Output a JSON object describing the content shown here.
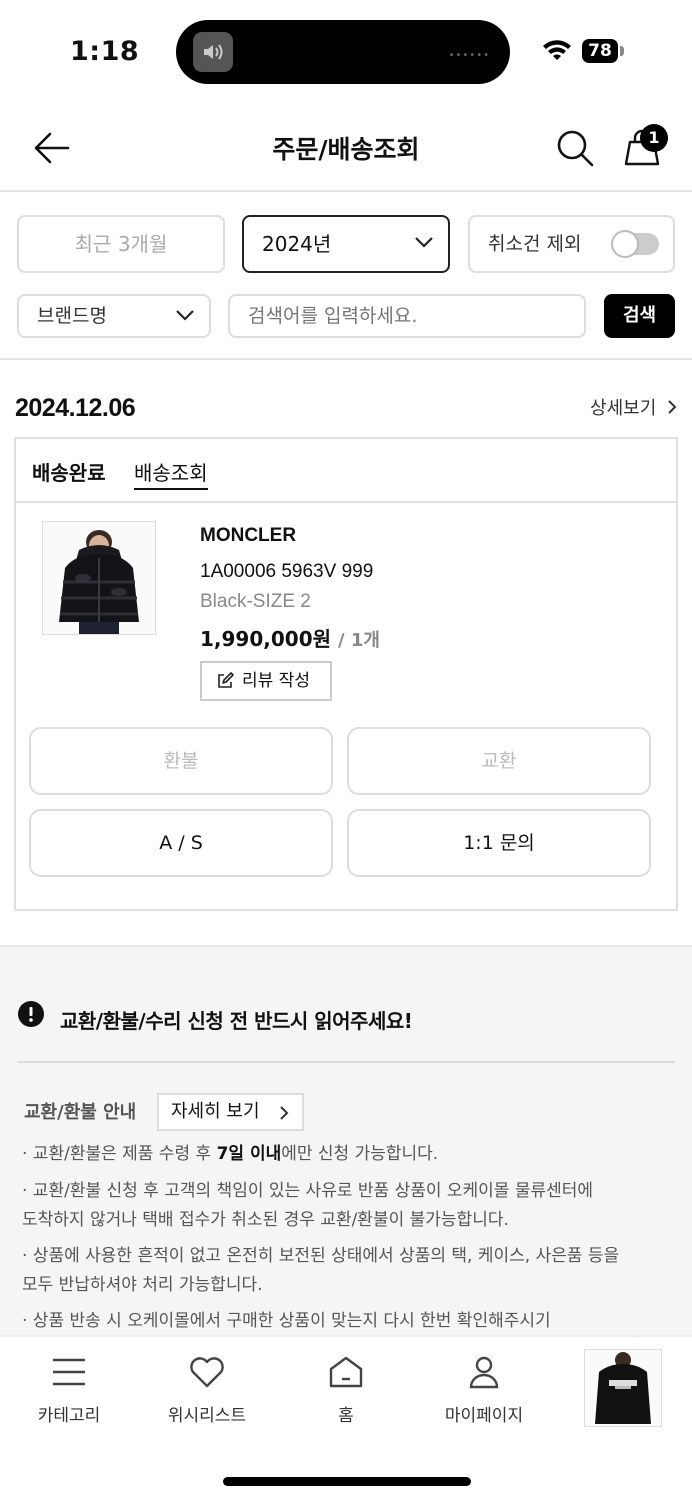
{
  "status_bar": {
    "time": "1:18",
    "battery": "78"
  },
  "header": {
    "title": "주문/배송조회",
    "cart_count": "1"
  },
  "filters": {
    "period": "최근 3개월",
    "year": "2024년",
    "exclude_cancel": "취소건 제외",
    "exclude_cancel_on": false,
    "brand": "브랜드명",
    "search_placeholder": "검색어를 입력하세요.",
    "search_button": "검색"
  },
  "order": {
    "date": "2024.12.06",
    "detail_link": "상세보기",
    "status": "배송완료",
    "tracking": "배송조회",
    "product": {
      "brand": "MONCLER",
      "code": "1A00006 5963V 999",
      "option": "Black-SIZE 2",
      "price": "1,990,000원",
      "qty": "/ 1개"
    },
    "review_button": "리뷰 작성",
    "actions": [
      "환불",
      "교환",
      "A / S",
      "1:1 문의"
    ]
  },
  "notice": {
    "title": "교환/환불/수리 신청 전 반드시 읽어주세요!",
    "guide_label": "교환/환불 안내",
    "guide_button": "자세히 보기",
    "l1_pre": "· 교환/환불은 제품 수령 후 ",
    "l1_bold": "7일 이내",
    "l1_post": "에만 신청 가능합니다.",
    "l2a": "· 교환/환불 신청 후 고객의 책임이 있는 사유로 반품 상품이 오케이몰 물류센터에",
    "l2b": "도착하지 않거나 택배 접수가 취소된 경우 교환/환불이 불가능합니다.",
    "l3a": "· 상품에 사용한 흔적이 없고 온전히 보전된 상태에서 상품의 택, 케이스, 사은품 등을",
    "l3b": "모두 반납하셔야 처리 가능합니다.",
    "l4": "· 상품 반송 시 오케이몰에서 구매한 상품이 맞는지 다시 한번 확인해주시기"
  },
  "bottom_nav": {
    "items": [
      "카테고리",
      "위시리스트",
      "홈",
      "마이페이지"
    ]
  }
}
